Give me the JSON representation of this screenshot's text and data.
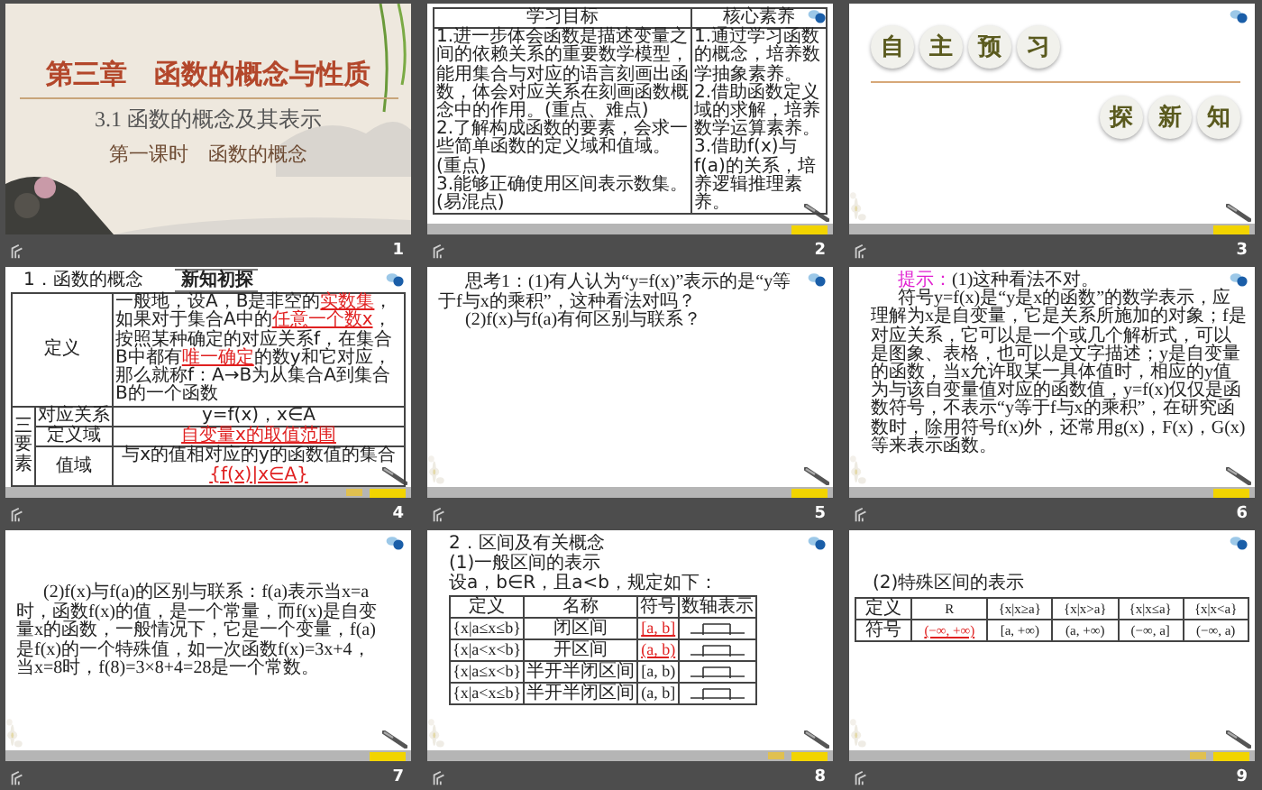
{
  "slides": [
    {
      "number": "1",
      "kind": "title",
      "chapter": "第三章　函数的概念与性质",
      "section": "3.1 函数的概念及其表示",
      "lesson": "第一课时　函数的概念"
    },
    {
      "number": "2",
      "kind": "objectives",
      "headers": [
        "学习目标",
        "核心素养"
      ],
      "left": [
        "1.进一步体会函数是描述变量之间的依赖关系的重要数学模型，能用集合与对应的语言刻画出函数，体会对应关系在刻画函数概念中的作用。(重点、难点)",
        "2.了解构成函数的要素，会求一些简单函数的定义域和值域。(重点)",
        "3.能够正确使用区间表示数集。(易混点)"
      ],
      "right": [
        "1.通过学习函数的概念，培养数学抽象素养。",
        "2.借助函数定义域的求解，培养数学运算素养。",
        "3.借助f(x)与f(a)的关系，培养逻辑推理素养。"
      ],
      "extra_button": false
    },
    {
      "number": "3",
      "kind": "banner",
      "top": [
        "自",
        "主",
        "预",
        "习"
      ],
      "bottom": [
        "探",
        "新",
        "知"
      ],
      "extra_button": false
    },
    {
      "number": "4",
      "kind": "concept",
      "badge": "新知初探",
      "heading": "1．函数的概念",
      "definition_label": "定义",
      "definition": [
        {
          "text": "一般地，设A，B是非空的",
          "highlight": false
        },
        {
          "text": "实数集",
          "highlight": true
        },
        {
          "text": "，如果对于集合A中的",
          "highlight": false
        },
        {
          "text": "任意一个数x",
          "highlight": true
        },
        {
          "text": "，按照某种确定的对应关系f，在集合B中都有",
          "highlight": false
        },
        {
          "text": "唯一确定",
          "highlight": true
        },
        {
          "text": "的数y和它对应，那么就称f：A→B为从集合A到集合B的一个函数",
          "highlight": false
        }
      ],
      "group_label": "三要素",
      "rows": [
        {
          "label": "对应关系",
          "value": [
            {
              "text": "y=f(x)，x∈A",
              "highlight": false
            }
          ]
        },
        {
          "label": "定义域",
          "value": [
            {
              "text": "自变量x的取值范围",
              "highlight": true
            }
          ]
        },
        {
          "label": "值域",
          "value": [
            {
              "text": "与x的值相对应的y的函数值的集合",
              "highlight": false
            },
            {
              "text": "{f(x)|x∈A}",
              "highlight": true
            }
          ]
        }
      ],
      "extra_button": true
    },
    {
      "number": "5",
      "kind": "text",
      "paragraphs": [
        "思考1：(1)有人认为“y=f(x)”表示的是“y等于f与x的乘积”，这种看法对吗？",
        "(2)f(x)与f(a)有何区别与联系？"
      ],
      "extra_button": false
    },
    {
      "number": "6",
      "kind": "hint",
      "hint_label": "提示：",
      "paragraphs": [
        "(1)这种看法不对。",
        "符号y=f(x)是“y是x的函数”的数学表示，应理解为x是自变量，它是关系所施加的对象；f是对应关系，它可以是一个或几个解析式，可以是图象、表格，也可以是文字描述；y是自变量的函数，当x允许取某一具体值时，相应的y值为与该自变量值对应的函数值，y=f(x)仅仅是函数符号，不表示“y等于f与x的乘积”，在研究函数时，除用符号f(x)外，还常用g(x)，F(x)，G(x)等来表示函数。"
      ],
      "extra_button": false
    },
    {
      "number": "7",
      "kind": "text",
      "paragraphs": [
        "(2)f(x)与f(a)的区别与联系：f(a)表示当x=a时，函数f(x)的值，是一个常量，而f(x)是自变量x的函数，一般情况下，它是一个变量，f(a)是f(x)的一个特殊值，如一次函数f(x)=3x+4，当x=8时，f(8)=3×8+4=28是一个常数。"
      ],
      "extra_button": false
    },
    {
      "number": "8",
      "kind": "intervals",
      "heading": "2．区间及有关概念",
      "subheading": "(1)一般区间的表示",
      "intro": "设a，b∈R，且a<b，规定如下：",
      "headers": [
        "定义",
        "名称",
        "符号",
        "数轴表示"
      ],
      "rows": [
        {
          "definition": "{x|a≤x≤b}",
          "name": "闭区间",
          "symbol": "[a, b]",
          "highlight": true
        },
        {
          "definition": "{x|a<x<b}",
          "name": "开区间",
          "symbol": "(a, b)",
          "highlight": true
        },
        {
          "definition": "{x|a≤x<b}",
          "name": "半开半闭区间",
          "symbol": "[a, b)",
          "highlight": false
        },
        {
          "definition": "{x|a<x≤b}",
          "name": "半开半闭区间",
          "symbol": "(a, b]",
          "highlight": false
        }
      ],
      "extra_button": true
    },
    {
      "number": "9",
      "kind": "special",
      "heading": "(2)特殊区间的表示",
      "rows": [
        {
          "label": "定义",
          "cells": [
            {
              "text": "R",
              "highlight": false
            },
            {
              "text": "{x|x≥a}",
              "highlight": false
            },
            {
              "text": "{x|x>a}",
              "highlight": false
            },
            {
              "text": "{x|x≤a}",
              "highlight": false
            },
            {
              "text": "{x|x<a}",
              "highlight": false
            }
          ]
        },
        {
          "label": "符号",
          "cells": [
            {
              "text": "(−∞, +∞)",
              "highlight": true
            },
            {
              "text": "[a, +∞)",
              "highlight": false
            },
            {
              "text": "(a, +∞)",
              "highlight": false
            },
            {
              "text": "(−∞, a]",
              "highlight": false
            },
            {
              "text": "(−∞, a)",
              "highlight": false
            }
          ]
        }
      ],
      "extra_button": true
    }
  ]
}
